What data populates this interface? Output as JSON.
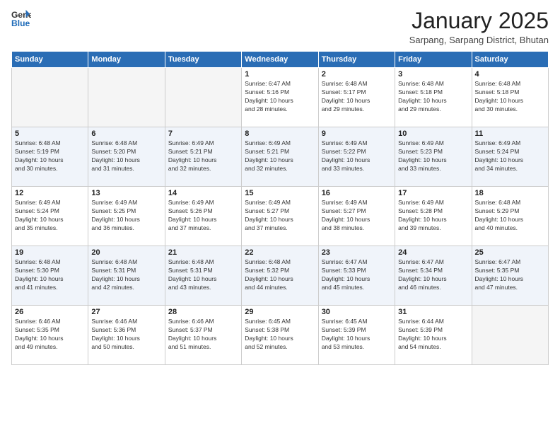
{
  "logo": {
    "general": "General",
    "blue": "Blue"
  },
  "title": {
    "month_year": "January 2025",
    "location": "Sarpang, Sarpang District, Bhutan"
  },
  "weekdays": [
    "Sunday",
    "Monday",
    "Tuesday",
    "Wednesday",
    "Thursday",
    "Friday",
    "Saturday"
  ],
  "weeks": [
    [
      {
        "day": "",
        "info": ""
      },
      {
        "day": "",
        "info": ""
      },
      {
        "day": "",
        "info": ""
      },
      {
        "day": "1",
        "info": "Sunrise: 6:47 AM\nSunset: 5:16 PM\nDaylight: 10 hours\nand 28 minutes."
      },
      {
        "day": "2",
        "info": "Sunrise: 6:48 AM\nSunset: 5:17 PM\nDaylight: 10 hours\nand 29 minutes."
      },
      {
        "day": "3",
        "info": "Sunrise: 6:48 AM\nSunset: 5:18 PM\nDaylight: 10 hours\nand 29 minutes."
      },
      {
        "day": "4",
        "info": "Sunrise: 6:48 AM\nSunset: 5:18 PM\nDaylight: 10 hours\nand 30 minutes."
      }
    ],
    [
      {
        "day": "5",
        "info": "Sunrise: 6:48 AM\nSunset: 5:19 PM\nDaylight: 10 hours\nand 30 minutes."
      },
      {
        "day": "6",
        "info": "Sunrise: 6:48 AM\nSunset: 5:20 PM\nDaylight: 10 hours\nand 31 minutes."
      },
      {
        "day": "7",
        "info": "Sunrise: 6:49 AM\nSunset: 5:21 PM\nDaylight: 10 hours\nand 32 minutes."
      },
      {
        "day": "8",
        "info": "Sunrise: 6:49 AM\nSunset: 5:21 PM\nDaylight: 10 hours\nand 32 minutes."
      },
      {
        "day": "9",
        "info": "Sunrise: 6:49 AM\nSunset: 5:22 PM\nDaylight: 10 hours\nand 33 minutes."
      },
      {
        "day": "10",
        "info": "Sunrise: 6:49 AM\nSunset: 5:23 PM\nDaylight: 10 hours\nand 33 minutes."
      },
      {
        "day": "11",
        "info": "Sunrise: 6:49 AM\nSunset: 5:24 PM\nDaylight: 10 hours\nand 34 minutes."
      }
    ],
    [
      {
        "day": "12",
        "info": "Sunrise: 6:49 AM\nSunset: 5:24 PM\nDaylight: 10 hours\nand 35 minutes."
      },
      {
        "day": "13",
        "info": "Sunrise: 6:49 AM\nSunset: 5:25 PM\nDaylight: 10 hours\nand 36 minutes."
      },
      {
        "day": "14",
        "info": "Sunrise: 6:49 AM\nSunset: 5:26 PM\nDaylight: 10 hours\nand 37 minutes."
      },
      {
        "day": "15",
        "info": "Sunrise: 6:49 AM\nSunset: 5:27 PM\nDaylight: 10 hours\nand 37 minutes."
      },
      {
        "day": "16",
        "info": "Sunrise: 6:49 AM\nSunset: 5:27 PM\nDaylight: 10 hours\nand 38 minutes."
      },
      {
        "day": "17",
        "info": "Sunrise: 6:49 AM\nSunset: 5:28 PM\nDaylight: 10 hours\nand 39 minutes."
      },
      {
        "day": "18",
        "info": "Sunrise: 6:48 AM\nSunset: 5:29 PM\nDaylight: 10 hours\nand 40 minutes."
      }
    ],
    [
      {
        "day": "19",
        "info": "Sunrise: 6:48 AM\nSunset: 5:30 PM\nDaylight: 10 hours\nand 41 minutes."
      },
      {
        "day": "20",
        "info": "Sunrise: 6:48 AM\nSunset: 5:31 PM\nDaylight: 10 hours\nand 42 minutes."
      },
      {
        "day": "21",
        "info": "Sunrise: 6:48 AM\nSunset: 5:31 PM\nDaylight: 10 hours\nand 43 minutes."
      },
      {
        "day": "22",
        "info": "Sunrise: 6:48 AM\nSunset: 5:32 PM\nDaylight: 10 hours\nand 44 minutes."
      },
      {
        "day": "23",
        "info": "Sunrise: 6:47 AM\nSunset: 5:33 PM\nDaylight: 10 hours\nand 45 minutes."
      },
      {
        "day": "24",
        "info": "Sunrise: 6:47 AM\nSunset: 5:34 PM\nDaylight: 10 hours\nand 46 minutes."
      },
      {
        "day": "25",
        "info": "Sunrise: 6:47 AM\nSunset: 5:35 PM\nDaylight: 10 hours\nand 47 minutes."
      }
    ],
    [
      {
        "day": "26",
        "info": "Sunrise: 6:46 AM\nSunset: 5:35 PM\nDaylight: 10 hours\nand 49 minutes."
      },
      {
        "day": "27",
        "info": "Sunrise: 6:46 AM\nSunset: 5:36 PM\nDaylight: 10 hours\nand 50 minutes."
      },
      {
        "day": "28",
        "info": "Sunrise: 6:46 AM\nSunset: 5:37 PM\nDaylight: 10 hours\nand 51 minutes."
      },
      {
        "day": "29",
        "info": "Sunrise: 6:45 AM\nSunset: 5:38 PM\nDaylight: 10 hours\nand 52 minutes."
      },
      {
        "day": "30",
        "info": "Sunrise: 6:45 AM\nSunset: 5:39 PM\nDaylight: 10 hours\nand 53 minutes."
      },
      {
        "day": "31",
        "info": "Sunrise: 6:44 AM\nSunset: 5:39 PM\nDaylight: 10 hours\nand 54 minutes."
      },
      {
        "day": "",
        "info": ""
      }
    ]
  ]
}
